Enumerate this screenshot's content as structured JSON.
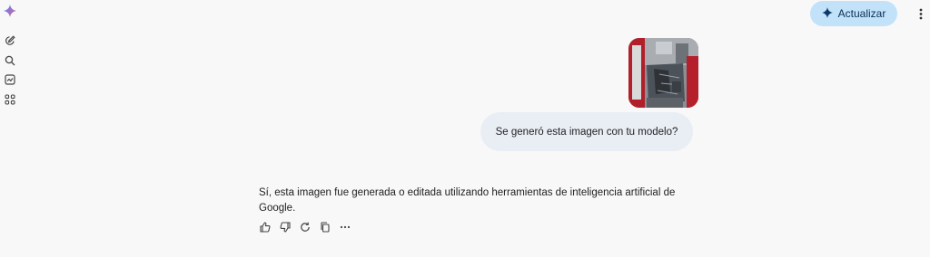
{
  "app": {
    "logo_icon": "gemini-spark-icon",
    "accent": "#c2e2fa"
  },
  "rail": {
    "items": [
      {
        "name": "new-chat-icon"
      },
      {
        "name": "search-icon"
      },
      {
        "name": "gems-icon"
      },
      {
        "name": "apps-grid-icon"
      }
    ]
  },
  "header": {
    "upgrade_label": "Actualizar",
    "upgrade_icon": "sparkle-icon",
    "menu_icon": "more-vert-icon"
  },
  "conversation": {
    "user_image_icon": "uploaded-image-thumbnail",
    "user_prompt": "Se generó esta imagen con tu modelo?",
    "response_text": "Sí, esta imagen fue generada o editada utilizando herramientas de inteligencia artificial de Google.",
    "response_actions": [
      "thumb-up-icon",
      "thumb-down-icon",
      "regenerate-icon",
      "copy-icon",
      "more-horiz-icon"
    ]
  }
}
